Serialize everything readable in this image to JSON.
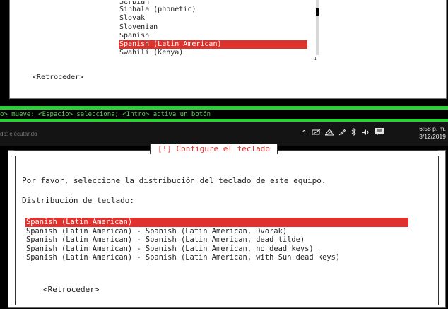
{
  "top_dialog": {
    "languages": [
      "Serbian",
      "Sinhala (phonetic)",
      "Slovak",
      "Slovenian",
      "Spanish",
      "Spanish (Latin American)",
      "Swahili (Kenya)"
    ],
    "selected_index": 5,
    "back_label": "<Retroceder>",
    "scroll_arrow": "↓"
  },
  "status_strip": {
    "text": "o> mueve: <Espacio> selecciona; <Intro> activa un botón"
  },
  "taskbar": {
    "task_label": "do: ejecutando",
    "icons": [
      "chevron-up-icon",
      "wifi-off-icon",
      "network-icon",
      "pen-icon",
      "bluetooth-icon",
      "volume-icon",
      "notification-icon"
    ],
    "time": "6:58 p. m.",
    "date": "3/12/2019"
  },
  "main_dialog": {
    "title": "[!] Configure el teclado",
    "prompt": "Por favor, seleccione la distribución del teclado de este equipo.",
    "field_label": "Distribución de teclado:",
    "layouts": [
      "Spanish (Latin American)",
      "Spanish (Latin American) - Spanish (Latin American, Dvorak)",
      "Spanish (Latin American) - Spanish (Latin American, dead tilde)",
      "Spanish (Latin American) - Spanish (Latin American, no dead keys)",
      "Spanish (Latin American) - Spanish (Latin American, with Sun dead keys)"
    ],
    "selected_index": 0,
    "back_label": "<Retroceder>"
  },
  "colors": {
    "selection": "#e0322d",
    "accent_green": "#2bcf36",
    "status_text": "#5fd35a",
    "taskbar": "#141414"
  }
}
